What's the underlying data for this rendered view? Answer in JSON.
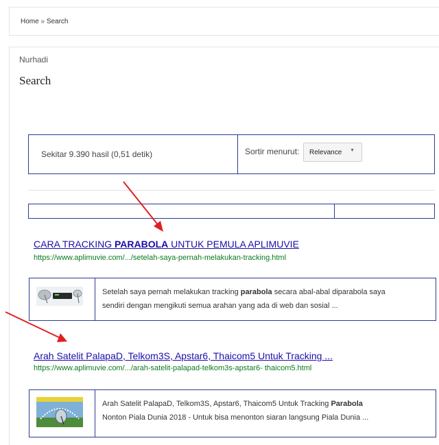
{
  "breadcrumb": {
    "home": "Home",
    "separator": "»",
    "current": "Search"
  },
  "author": "Nurhadi",
  "page_title": "Search",
  "results_info": "Sekitar 9.390 hasil (0,51 detik)",
  "sort": {
    "label": "Sortir menurut:",
    "selected": "Relevance"
  },
  "results": [
    {
      "title_pre": "CARA TRACKING ",
      "title_bold": "PARABOLA",
      "title_post": " UNTUK PEMULA APLIMUVIE",
      "url": "https://www.aplimuvie.com/.../setelah-saya-pernah-melakukan-tracking.html",
      "snippet_line1_pre": "Setelah saya pernah melakukan tracking ",
      "snippet_line1_bold": "parabola",
      "snippet_line1_post": " secara abal-abal diparabola saya",
      "snippet_line2": "sendiri dengan mengikuti semua arahan yang ada di web dan sosial ..."
    },
    {
      "title": "Arah Satelit PalapaD, Telkom3S, Apstar6, Thaicom5 Untuk Tracking ...",
      "url": "https://www.aplimuvie.com/.../arah-satelit-palapad-telkom3s-apstar6- thaicom5.html",
      "snippet_line1_pre": "Arah Satelit PalapaD, Telkom3S, Apstar6, Thaicom5 Untuk Tracking ",
      "snippet_line1_bold": "Parabola",
      "snippet_line2": "Nonton Piala Dunia 2018 - Untuk bisa menonton siaran langsung Piala Dunia ..."
    }
  ],
  "colors": {
    "link": "#1a0dab",
    "url": "#0a7a1f",
    "border": "#2b3a8f",
    "arrow": "#e02020"
  }
}
